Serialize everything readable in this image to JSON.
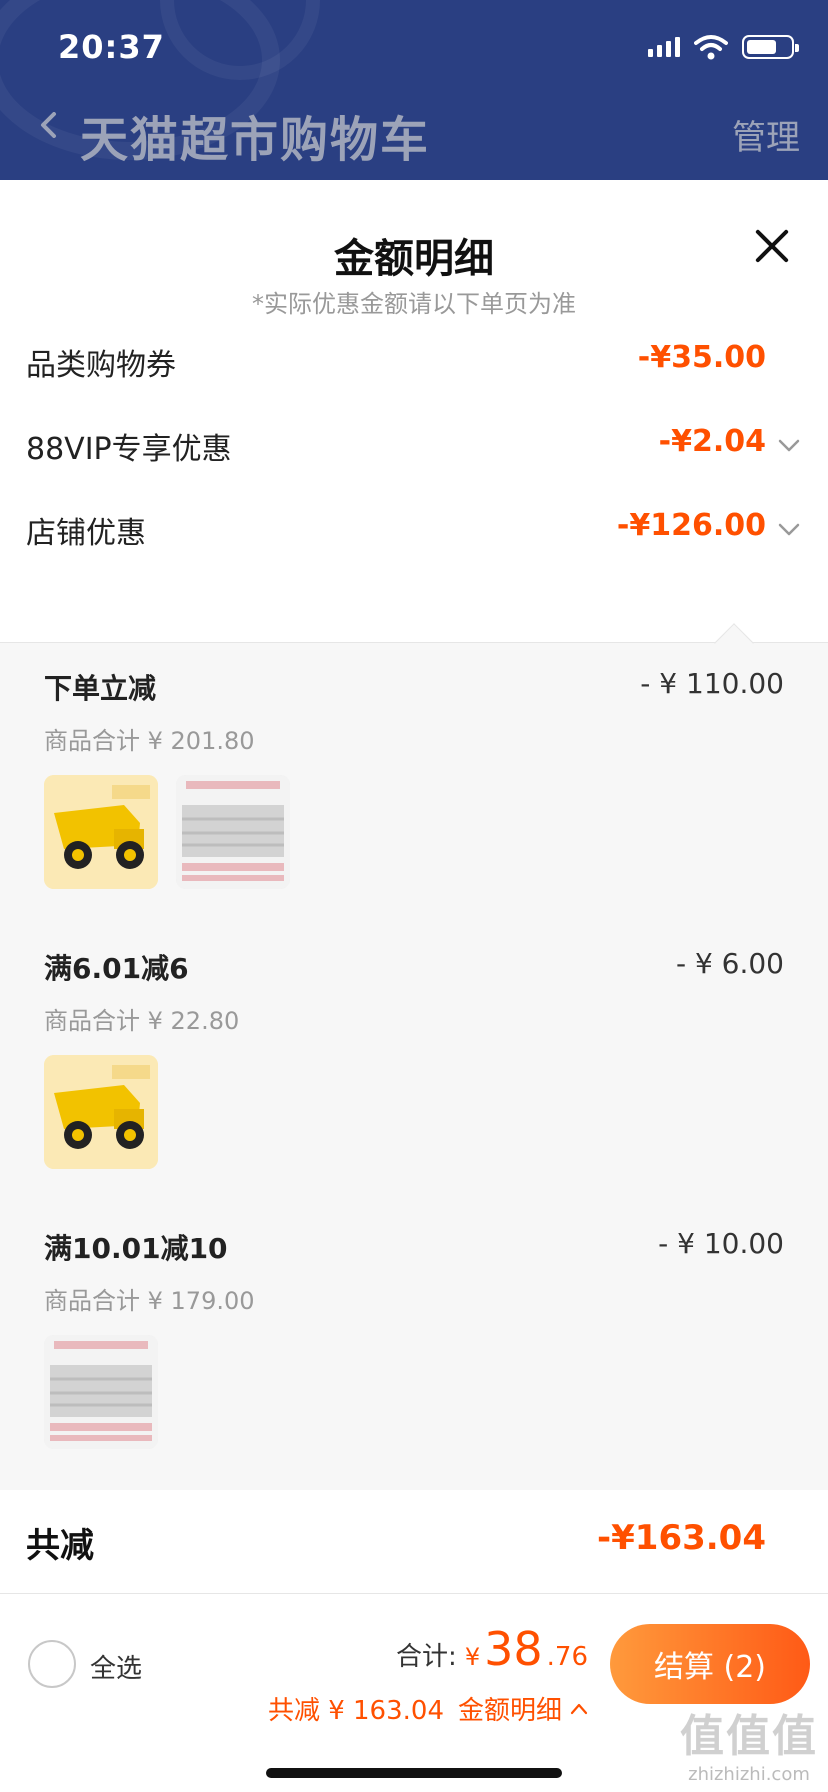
{
  "status_bar": {
    "time": "20:37"
  },
  "nav": {
    "title": "天猫超市购物车",
    "manage_label": "管理"
  },
  "sheet": {
    "title": "金额明细",
    "subtitle": "*实际优惠金额请以下单页为准",
    "rows": [
      {
        "label": "品类购物券",
        "amount": "-¥35.00"
      },
      {
        "label": "88VIP专享优惠",
        "amount": "-¥2.04"
      },
      {
        "label": "店铺优惠",
        "amount": "-¥126.00"
      }
    ],
    "groups": [
      {
        "name": "下单立减",
        "amount": "- ¥ 110.00",
        "subtotal": "商品合计 ¥ 201.80",
        "thumbs": [
          "truck-toy-thumbnail",
          "bedding-thumbnail"
        ]
      },
      {
        "name": "满6.01减6",
        "amount": "- ¥ 6.00",
        "subtotal": "商品合计 ¥ 22.80",
        "thumbs": [
          "truck-toy-thumbnail"
        ]
      },
      {
        "name": "满10.01减10",
        "amount": "- ¥ 10.00",
        "subtotal": "商品合计 ¥ 179.00",
        "thumbs": [
          "bedding-thumbnail"
        ]
      }
    ],
    "total": {
      "label": "共减",
      "amount": "-¥163.04"
    }
  },
  "bottom_bar": {
    "select_all_label": "全选",
    "sum_label": "合计:",
    "sum_currency": "¥",
    "sum_integer": "38",
    "sum_decimal": ".76",
    "saved_text": "共减 ¥ 163.04",
    "detail_link": "金额明细",
    "checkout_label": "结算 (2)"
  },
  "watermark": {
    "big": "值值值",
    "small": "zhizhizhi.com"
  },
  "colors": {
    "header_bg": "#2a3f82",
    "accent": "#ff5000",
    "checkout_gradient_start": "#ff9a3c",
    "checkout_gradient_end": "#ff5a16"
  }
}
